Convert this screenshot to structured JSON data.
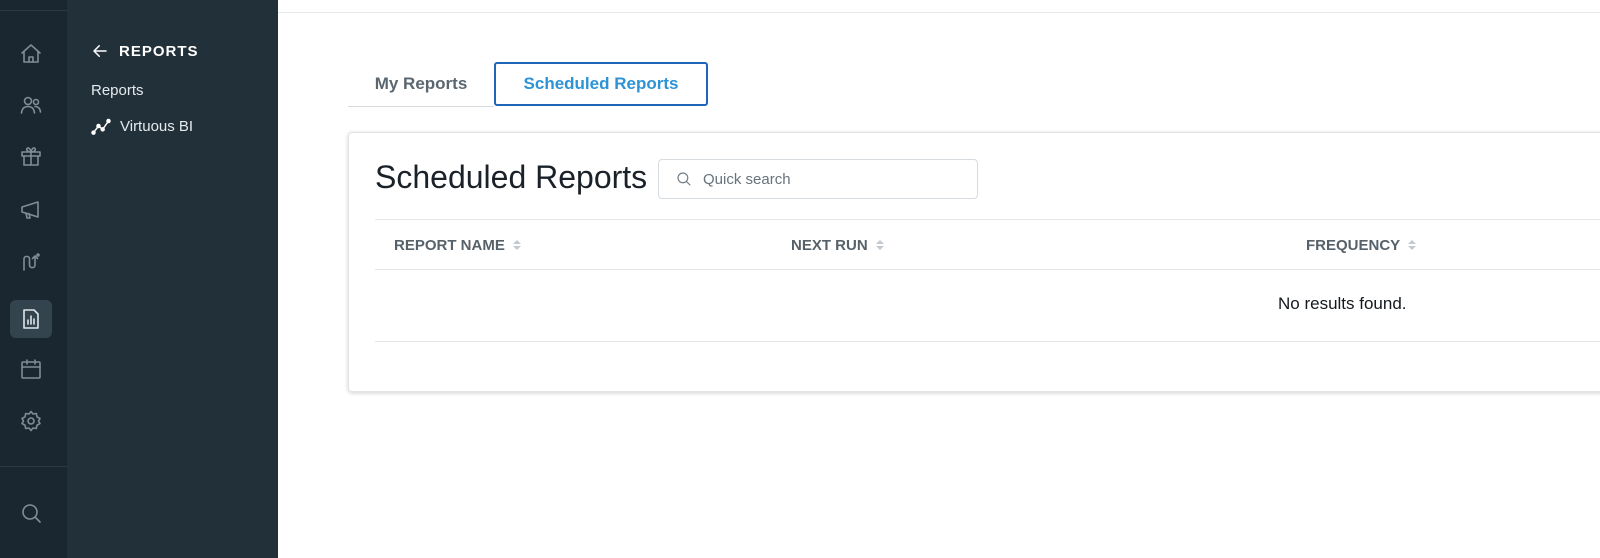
{
  "rail": {
    "icons": [
      "home-icon",
      "people-icon",
      "gift-icon",
      "megaphone-icon",
      "journey-icon",
      "reports-icon",
      "calendar-icon",
      "settings-icon",
      "search-icon"
    ],
    "active": "reports-icon"
  },
  "subnav": {
    "title": "REPORTS",
    "links": [
      {
        "label": "Reports"
      },
      {
        "label": "Virtuous BI",
        "icon": "line-chart-icon"
      }
    ]
  },
  "tabs": [
    {
      "label": "My Reports",
      "active": false
    },
    {
      "label": "Scheduled Reports",
      "active": true
    }
  ],
  "card": {
    "title": "Scheduled Reports",
    "search": {
      "placeholder": "Quick search",
      "value": ""
    },
    "columns": [
      "REPORT NAME",
      "NEXT RUN",
      "FREQUENCY"
    ],
    "rows": [],
    "empty_message": "No results found."
  },
  "colors": {
    "rail_bg": "#1b2730",
    "subnav_bg": "#223039",
    "tab_active_text": "#2e93d6",
    "tab_active_border": "#1f66b8"
  }
}
